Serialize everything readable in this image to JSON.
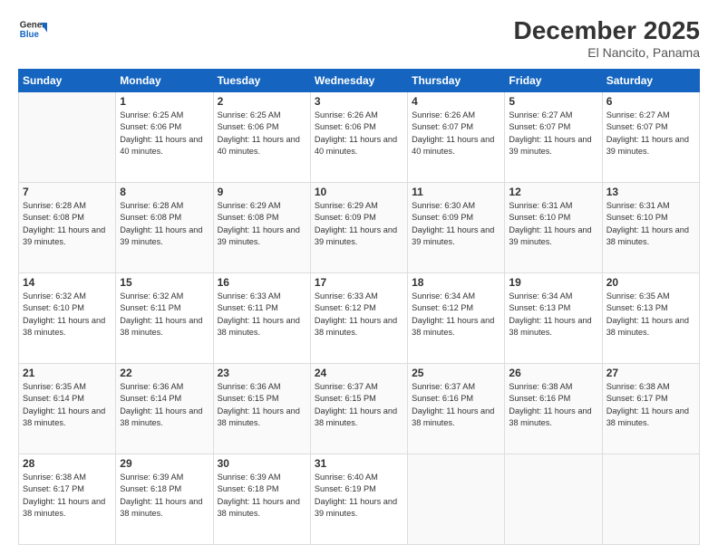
{
  "header": {
    "logo_general": "General",
    "logo_blue": "Blue",
    "title": "December 2025",
    "location": "El Nancito, Panama"
  },
  "days_of_week": [
    "Sunday",
    "Monday",
    "Tuesday",
    "Wednesday",
    "Thursday",
    "Friday",
    "Saturday"
  ],
  "weeks": [
    [
      {
        "day": null
      },
      {
        "day": "1",
        "sunrise": "6:25 AM",
        "sunset": "6:06 PM",
        "daylight": "11 hours and 40 minutes."
      },
      {
        "day": "2",
        "sunrise": "6:25 AM",
        "sunset": "6:06 PM",
        "daylight": "11 hours and 40 minutes."
      },
      {
        "day": "3",
        "sunrise": "6:26 AM",
        "sunset": "6:06 PM",
        "daylight": "11 hours and 40 minutes."
      },
      {
        "day": "4",
        "sunrise": "6:26 AM",
        "sunset": "6:07 PM",
        "daylight": "11 hours and 40 minutes."
      },
      {
        "day": "5",
        "sunrise": "6:27 AM",
        "sunset": "6:07 PM",
        "daylight": "11 hours and 39 minutes."
      },
      {
        "day": "6",
        "sunrise": "6:27 AM",
        "sunset": "6:07 PM",
        "daylight": "11 hours and 39 minutes."
      }
    ],
    [
      {
        "day": "7",
        "sunrise": "6:28 AM",
        "sunset": "6:08 PM",
        "daylight": "11 hours and 39 minutes."
      },
      {
        "day": "8",
        "sunrise": "6:28 AM",
        "sunset": "6:08 PM",
        "daylight": "11 hours and 39 minutes."
      },
      {
        "day": "9",
        "sunrise": "6:29 AM",
        "sunset": "6:08 PM",
        "daylight": "11 hours and 39 minutes."
      },
      {
        "day": "10",
        "sunrise": "6:29 AM",
        "sunset": "6:09 PM",
        "daylight": "11 hours and 39 minutes."
      },
      {
        "day": "11",
        "sunrise": "6:30 AM",
        "sunset": "6:09 PM",
        "daylight": "11 hours and 39 minutes."
      },
      {
        "day": "12",
        "sunrise": "6:31 AM",
        "sunset": "6:10 PM",
        "daylight": "11 hours and 39 minutes."
      },
      {
        "day": "13",
        "sunrise": "6:31 AM",
        "sunset": "6:10 PM",
        "daylight": "11 hours and 38 minutes."
      }
    ],
    [
      {
        "day": "14",
        "sunrise": "6:32 AM",
        "sunset": "6:10 PM",
        "daylight": "11 hours and 38 minutes."
      },
      {
        "day": "15",
        "sunrise": "6:32 AM",
        "sunset": "6:11 PM",
        "daylight": "11 hours and 38 minutes."
      },
      {
        "day": "16",
        "sunrise": "6:33 AM",
        "sunset": "6:11 PM",
        "daylight": "11 hours and 38 minutes."
      },
      {
        "day": "17",
        "sunrise": "6:33 AM",
        "sunset": "6:12 PM",
        "daylight": "11 hours and 38 minutes."
      },
      {
        "day": "18",
        "sunrise": "6:34 AM",
        "sunset": "6:12 PM",
        "daylight": "11 hours and 38 minutes."
      },
      {
        "day": "19",
        "sunrise": "6:34 AM",
        "sunset": "6:13 PM",
        "daylight": "11 hours and 38 minutes."
      },
      {
        "day": "20",
        "sunrise": "6:35 AM",
        "sunset": "6:13 PM",
        "daylight": "11 hours and 38 minutes."
      }
    ],
    [
      {
        "day": "21",
        "sunrise": "6:35 AM",
        "sunset": "6:14 PM",
        "daylight": "11 hours and 38 minutes."
      },
      {
        "day": "22",
        "sunrise": "6:36 AM",
        "sunset": "6:14 PM",
        "daylight": "11 hours and 38 minutes."
      },
      {
        "day": "23",
        "sunrise": "6:36 AM",
        "sunset": "6:15 PM",
        "daylight": "11 hours and 38 minutes."
      },
      {
        "day": "24",
        "sunrise": "6:37 AM",
        "sunset": "6:15 PM",
        "daylight": "11 hours and 38 minutes."
      },
      {
        "day": "25",
        "sunrise": "6:37 AM",
        "sunset": "6:16 PM",
        "daylight": "11 hours and 38 minutes."
      },
      {
        "day": "26",
        "sunrise": "6:38 AM",
        "sunset": "6:16 PM",
        "daylight": "11 hours and 38 minutes."
      },
      {
        "day": "27",
        "sunrise": "6:38 AM",
        "sunset": "6:17 PM",
        "daylight": "11 hours and 38 minutes."
      }
    ],
    [
      {
        "day": "28",
        "sunrise": "6:38 AM",
        "sunset": "6:17 PM",
        "daylight": "11 hours and 38 minutes."
      },
      {
        "day": "29",
        "sunrise": "6:39 AM",
        "sunset": "6:18 PM",
        "daylight": "11 hours and 38 minutes."
      },
      {
        "day": "30",
        "sunrise": "6:39 AM",
        "sunset": "6:18 PM",
        "daylight": "11 hours and 38 minutes."
      },
      {
        "day": "31",
        "sunrise": "6:40 AM",
        "sunset": "6:19 PM",
        "daylight": "11 hours and 39 minutes."
      },
      {
        "day": null
      },
      {
        "day": null
      },
      {
        "day": null
      }
    ]
  ]
}
